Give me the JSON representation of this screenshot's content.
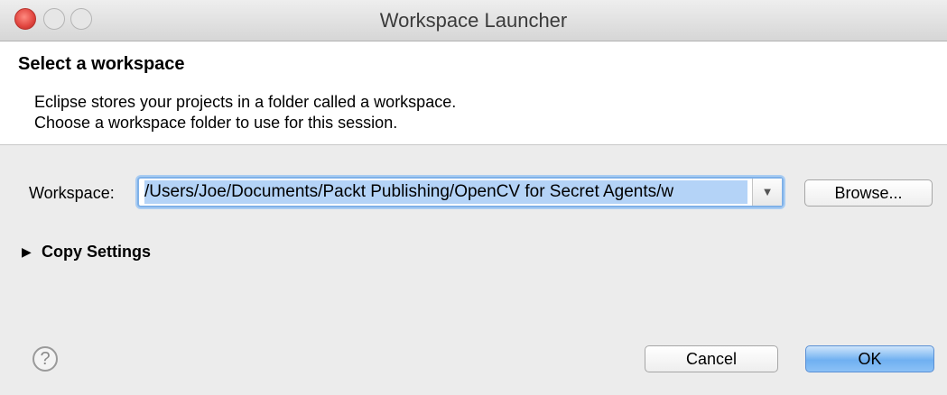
{
  "window": {
    "title": "Workspace Launcher"
  },
  "header": {
    "title": "Select a workspace",
    "description": [
      "Eclipse stores your projects in a folder called a workspace.",
      "Choose a workspace folder to use for this session."
    ]
  },
  "workspace": {
    "label": "Workspace:",
    "value": "/Users/Joe/Documents/Packt Publishing/OpenCV for Secret Agents/w",
    "dropdown_icon": "▼",
    "browse_label": "Browse..."
  },
  "copy_settings": {
    "toggle_icon": "▶",
    "label": "Copy Settings"
  },
  "footer": {
    "help_icon": "?",
    "cancel_label": "Cancel",
    "ok_label": "OK"
  },
  "colors": {
    "selection": "#b4d3f7",
    "focus_ring": "#7fb1e8",
    "close_button": "#e0443e",
    "default_button": "#6fb0f1"
  }
}
